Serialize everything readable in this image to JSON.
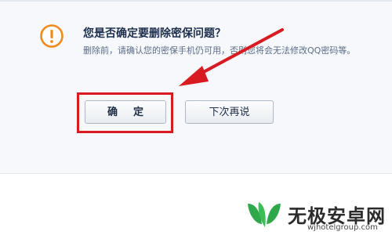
{
  "dialog": {
    "icon": "exclamation-warning-icon",
    "title": "您是否确定要删除密保问题？",
    "message": "删除前，请确认您的密保手机仍可用，否则您将会无法修改QQ密码等。",
    "confirm_label": "确定",
    "later_label": "下次再说"
  },
  "annotation": {
    "highlight_color": "#d81b21",
    "arrow_color": "#d81b21"
  },
  "watermark": {
    "logo_icon": "w-leaf-logo-icon",
    "brand": "无极安卓网",
    "url": "wjhotelgroup.com",
    "logo_color": "#2ea84a"
  }
}
